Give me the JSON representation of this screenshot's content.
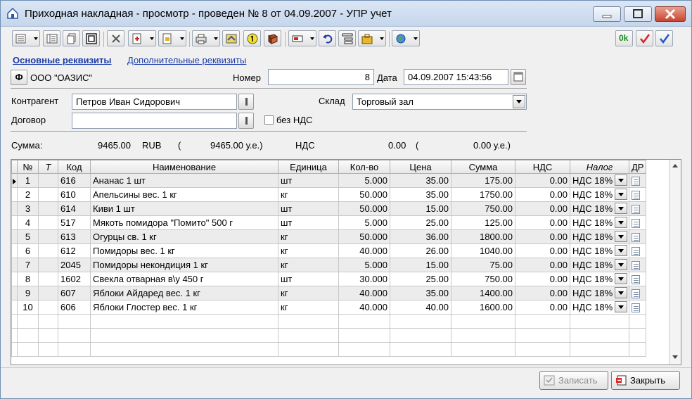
{
  "window": {
    "title": "Приходная накладная - просмотр - проведен № 8 от 04.09.2007 - УПР учет"
  },
  "toolbar_icons": [
    "list-menu-icon",
    "form-icon",
    "copy-icon",
    "open-icon",
    "delete-icon",
    "fill-icon",
    "document-icon",
    "print-icon",
    "post-icon",
    "number-one-icon",
    "book-icon",
    "message-icon",
    "undo-icon",
    "structure-icon",
    "tasks-icon",
    "globe-icon",
    "ok-icon",
    "checkmark-red-icon",
    "checkmark-blue-icon"
  ],
  "toolbar": {
    "ok_label": "0k"
  },
  "tabs": {
    "main": "Основные реквизиты",
    "extra": "Дополнительные реквизиты"
  },
  "header": {
    "org_button": "Ф",
    "org_name": "ООО \"ОАЗИС\"",
    "number_label": "Номер",
    "number_value": "8",
    "date_label": "Дата",
    "date_value": "04.09.2007 15:43:56",
    "counterparty_label": "Контрагент",
    "counterparty_value": "Петров Иван Сидорович",
    "warehouse_label": "Склад",
    "warehouse_value": "Торговый зал",
    "contract_label": "Договор",
    "contract_value": "",
    "no_vat_label": "без НДС",
    "no_vat_checked": false
  },
  "summary": {
    "sum_label": "Сумма:",
    "sum_value": "9465.00",
    "currency": "RUB",
    "paren_open": "(",
    "ue_value": "9465.00 у.е.)",
    "vat_label": "НДС",
    "vat_value": "0.00",
    "vat_paren_open": "(",
    "vat_ue_value": "0.00 у.е.)"
  },
  "table": {
    "columns": [
      "№",
      "Т",
      "Код",
      "Наименование",
      "Единица",
      "Кол-во",
      "Цена",
      "Сумма",
      "НДС",
      "Налог",
      "ДР"
    ],
    "rows": [
      {
        "n": "1",
        "t": "",
        "code": "616",
        "name": "Ананас 1 шт",
        "unit": "шт",
        "qty": "5.000",
        "price": "35.00",
        "sum": "175.00",
        "vat": "0.00",
        "tax": "НДС 18%"
      },
      {
        "n": "2",
        "t": "",
        "code": "610",
        "name": "Апельсины вес. 1 кг",
        "unit": "кг",
        "qty": "50.000",
        "price": "35.00",
        "sum": "1750.00",
        "vat": "0.00",
        "tax": "НДС 18%"
      },
      {
        "n": "3",
        "t": "",
        "code": "614",
        "name": "Киви 1 шт",
        "unit": "шт",
        "qty": "50.000",
        "price": "15.00",
        "sum": "750.00",
        "vat": "0.00",
        "tax": "НДС 18%"
      },
      {
        "n": "4",
        "t": "",
        "code": "517",
        "name": "Мякоть помидора \"Помито\" 500 г",
        "unit": "шт",
        "qty": "5.000",
        "price": "25.00",
        "sum": "125.00",
        "vat": "0.00",
        "tax": "НДС 18%"
      },
      {
        "n": "5",
        "t": "",
        "code": "613",
        "name": "Огурцы св. 1 кг",
        "unit": "кг",
        "qty": "50.000",
        "price": "36.00",
        "sum": "1800.00",
        "vat": "0.00",
        "tax": "НДС 18%"
      },
      {
        "n": "6",
        "t": "",
        "code": "612",
        "name": "Помидоры вес. 1 кг",
        "unit": "кг",
        "qty": "40.000",
        "price": "26.00",
        "sum": "1040.00",
        "vat": "0.00",
        "tax": "НДС 18%"
      },
      {
        "n": "7",
        "t": "",
        "code": "2045",
        "name": "Помидоры некондиция 1 кг",
        "unit": "кг",
        "qty": "5.000",
        "price": "15.00",
        "sum": "75.00",
        "vat": "0.00",
        "tax": "НДС 18%"
      },
      {
        "n": "8",
        "t": "",
        "code": "1602",
        "name": "Свекла отварная в\\у 450 г",
        "unit": "шт",
        "qty": "30.000",
        "price": "25.00",
        "sum": "750.00",
        "vat": "0.00",
        "tax": "НДС 18%"
      },
      {
        "n": "9",
        "t": "",
        "code": "607",
        "name": "Яблоки Айдаред вес. 1 кг",
        "unit": "кг",
        "qty": "40.000",
        "price": "35.00",
        "sum": "1400.00",
        "vat": "0.00",
        "tax": "НДС 18%"
      },
      {
        "n": "10",
        "t": "",
        "code": "606",
        "name": "Яблоки Глостер вес. 1 кг",
        "unit": "кг",
        "qty": "40.000",
        "price": "40.00",
        "sum": "1600.00",
        "vat": "0.00",
        "tax": "НДС 18%"
      }
    ]
  },
  "buttons": {
    "save": "Записать",
    "close": "Закрыть"
  },
  "colors": {
    "title_bg": "#c5d6ec",
    "link": "#1b3ca8",
    "alt_row": "#ececec",
    "close_button": "#c9452f"
  }
}
